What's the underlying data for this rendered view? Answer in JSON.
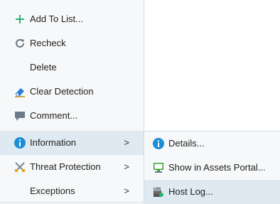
{
  "main_menu": {
    "items": [
      {
        "label": "Add To List...",
        "icon": "plus-icon"
      },
      {
        "label": "Recheck",
        "icon": "refresh-icon"
      },
      {
        "label": "Delete",
        "icon": ""
      },
      {
        "label": "Clear Detection",
        "icon": "eraser-icon"
      },
      {
        "label": "Comment...",
        "icon": "comment-icon"
      },
      {
        "label": "Information",
        "icon": "info-icon",
        "arrow": ">",
        "highlighted": true
      },
      {
        "label": "Threat Protection",
        "icon": "threat-protection-icon",
        "arrow": ">"
      },
      {
        "label": "Exceptions",
        "icon": "",
        "arrow": ">"
      }
    ]
  },
  "sub_menu": {
    "items": [
      {
        "label": "Details...",
        "icon": "info-icon"
      },
      {
        "label": "Show in Assets Portal...",
        "icon": "monitor-icon"
      },
      {
        "label": "Host Log...",
        "icon": "log-icon",
        "icon_text": "LOG",
        "highlighted": true
      }
    ]
  },
  "colors": {
    "highlight": "#dfe9f1",
    "info_blue": "#1a8fd6",
    "plus_green": "#2bb673",
    "monitor_green": "#3b9e3b"
  }
}
